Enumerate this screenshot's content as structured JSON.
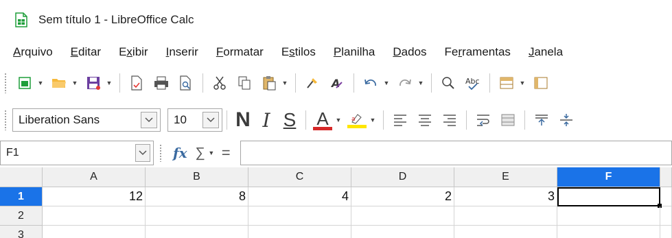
{
  "window": {
    "title": "Sem título 1 - LibreOffice Calc"
  },
  "menu": [
    {
      "label": "Arquivo",
      "acc": "A",
      "rest": "rquivo"
    },
    {
      "label": "Editar",
      "acc": "E",
      "rest": "ditar"
    },
    {
      "label": "Exibir",
      "acc": "E",
      "rest": "xibir",
      "acc_index": 1
    },
    {
      "label": "Inserir",
      "acc": "I",
      "rest": "nserir"
    },
    {
      "label": "Formatar",
      "acc": "F",
      "rest": "ormatar"
    },
    {
      "label": "Estilos",
      "acc": "s",
      "rest": "tilos"
    },
    {
      "label": "Planilha",
      "acc": "P",
      "rest": "lanilha"
    },
    {
      "label": "Dados",
      "acc": "D",
      "rest": "ados"
    },
    {
      "label": "Ferramentas",
      "acc": "r",
      "rest": "ramentas"
    },
    {
      "label": "Janela",
      "acc": "J",
      "rest": "anela"
    }
  ],
  "formatting": {
    "font_name": "Liberation Sans",
    "font_size": "10",
    "bold_glyph": "N",
    "italic_glyph": "I",
    "underline_glyph": "S",
    "font_color_glyph": "A",
    "font_color": "#d62828",
    "highlight_color": "#ffe600"
  },
  "formula_bar": {
    "name_box": "F1",
    "fx": "fx",
    "sigma": "∑",
    "equals": "=",
    "content": ""
  },
  "sheet": {
    "columns": [
      "A",
      "B",
      "C",
      "D",
      "E",
      "F"
    ],
    "selected_column": "F",
    "rows": [
      {
        "header": "1",
        "selected": true,
        "cells": [
          "12",
          "8",
          "4",
          "2",
          "3",
          ""
        ]
      },
      {
        "header": "2",
        "selected": false,
        "cells": [
          "",
          "",
          "",
          "",
          "",
          ""
        ]
      },
      {
        "header": "3",
        "selected": false,
        "cells": [
          "",
          "",
          "",
          "",
          "",
          ""
        ]
      }
    ],
    "active_cell": "F1"
  },
  "colors": {
    "selection": "#1a73e8",
    "calc_green": "#1e9e3a"
  }
}
